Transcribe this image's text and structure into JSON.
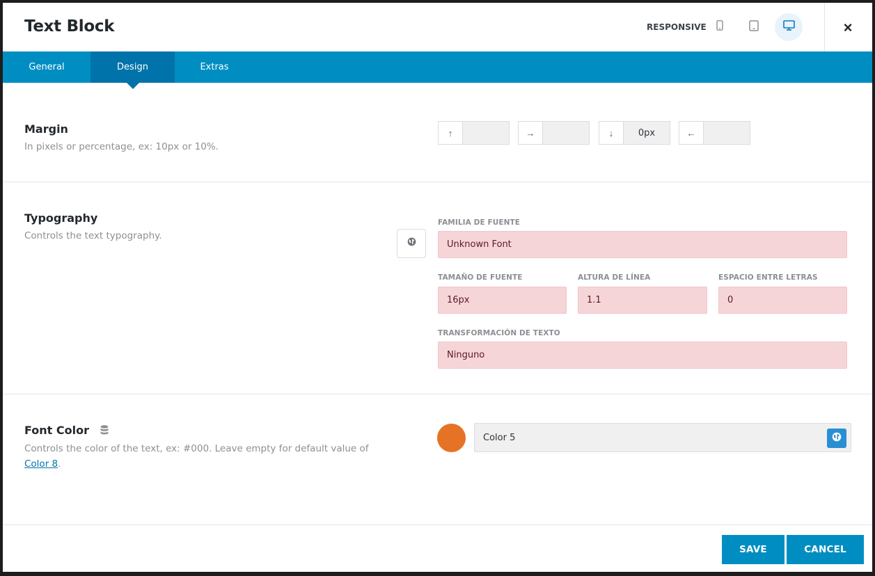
{
  "header": {
    "title": "Text Block",
    "responsive_label": "RESPONSIVE",
    "devices": [
      {
        "name": "mobile-icon",
        "active": false
      },
      {
        "name": "tablet-icon",
        "active": false
      },
      {
        "name": "desktop-icon",
        "active": true
      }
    ],
    "close_label": "×"
  },
  "tabs": [
    {
      "label": "General",
      "active": false
    },
    {
      "label": "Design",
      "active": true
    },
    {
      "label": "Extras",
      "active": false
    }
  ],
  "margin": {
    "title": "Margin",
    "description": "In pixels or percentage, ex: 10px or 10%.",
    "fields": [
      {
        "icon": "arrow-up-icon",
        "glyph": "↑",
        "value": ""
      },
      {
        "icon": "arrow-right-icon",
        "glyph": "→",
        "value": ""
      },
      {
        "icon": "arrow-down-icon",
        "glyph": "↓",
        "value": "0px"
      },
      {
        "icon": "arrow-left-icon",
        "glyph": "←",
        "value": ""
      }
    ]
  },
  "typography": {
    "title": "Typography",
    "description": "Controls the text typography.",
    "font_family_label": "FAMILIA DE FUENTE",
    "font_family_value": "Unknown Font",
    "font_size_label": "TAMAÑO DE FUENTE",
    "font_size_value": "16px",
    "line_height_label": "ALTURA DE LÍNEA",
    "line_height_value": "1.1",
    "letter_spacing_label": "ESPACIO ENTRE LETRAS",
    "letter_spacing_value": "0",
    "text_transform_label": "TRANSFORMACIÓN DE TEXTO",
    "text_transform_value": "Ninguno"
  },
  "font_color": {
    "title": "Font Color",
    "description_prefix": "Controls the color of the text, ex: #000. Leave empty for default value of",
    "description_link": "Color 8",
    "description_suffix": ".",
    "swatch_color": "#e67325",
    "selected_value": "Color 5"
  },
  "footer": {
    "save_label": "SAVE",
    "cancel_label": "CANCEL"
  },
  "colors": {
    "accent": "#008ec2",
    "accent_dark": "#0073aa",
    "error_field_bg": "#f6d5d8"
  }
}
